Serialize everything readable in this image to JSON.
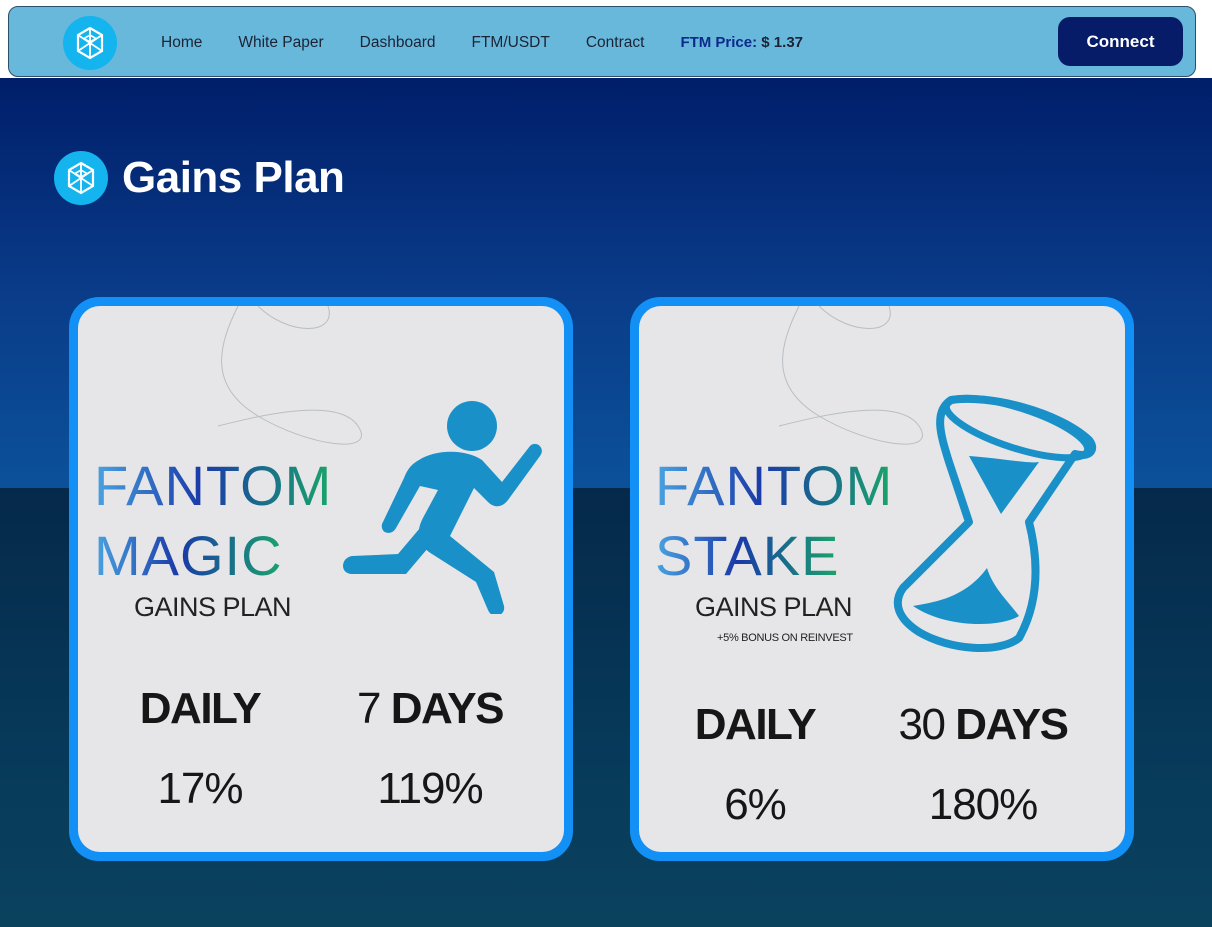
{
  "navbar": {
    "logo_icon": "fantom-logo-icon",
    "links": [
      "Home",
      "White Paper",
      "Dashboard",
      "FTM/USDT",
      "Contract"
    ],
    "price_label": "FTM Price:",
    "price_value": "$ 1.37",
    "connect_label": "Connect"
  },
  "page": {
    "title": "Gains Plan",
    "title_icon": "fantom-logo-icon"
  },
  "plans": [
    {
      "name_line1": "FANTOM",
      "name_line2": "MAGIC",
      "subtitle": "GAINS PLAN",
      "bonus": "",
      "icon": "running-man-icon",
      "left_head": "DAILY",
      "right_head_num": "7",
      "right_head_word": "DAYS",
      "left_value": "17%",
      "right_value": "119%"
    },
    {
      "name_line1": "FANTOM",
      "name_line2": "STAKE",
      "subtitle": "GAINS PLAN",
      "bonus": "+5% BONUS ON REINVEST",
      "icon": "hourglass-icon",
      "left_head": "DAILY",
      "right_head_num": "30",
      "right_head_word": "DAYS",
      "left_value": "6%",
      "right_value": "180%"
    }
  ],
  "colors": {
    "navbar_bg": "#68b8dc",
    "connect_bg": "#071c68",
    "card_border": "#1290f5",
    "icon_blue": "#1a90c9",
    "logo_bg": "#14b4ef"
  }
}
